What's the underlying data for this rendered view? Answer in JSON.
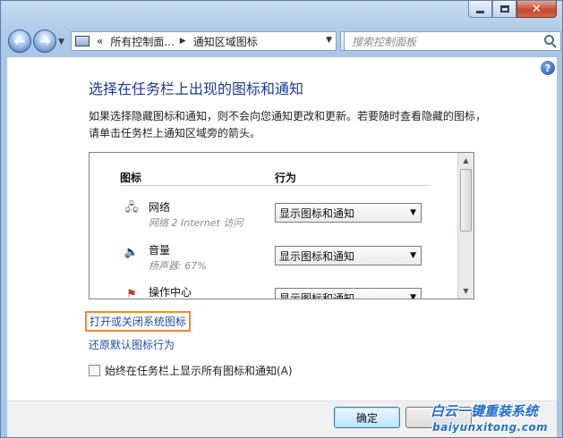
{
  "window": {
    "controls": {
      "minimize_icon": "minimize-icon",
      "maximize_icon": "maximize-icon",
      "close_glyph": "✕"
    }
  },
  "nav": {
    "back_glyph": "←",
    "forward_glyph": "→",
    "address": {
      "prefix": "«",
      "segments": [
        "所有控制面...",
        "通知区域图标"
      ]
    },
    "search_placeholder": "搜索控制面板"
  },
  "main": {
    "help_glyph": "?",
    "title": "选择在任务栏上出现的图标和通知",
    "description": "如果选择隐藏图标和通知，则不会向您通知更改和更新。若要随时查看隐藏的图标，请单击任务栏上通知区域旁的箭头。",
    "table": {
      "headers": {
        "icon": "图标",
        "action": "行为"
      },
      "rows": [
        {
          "name": "网络",
          "subtitle": "网络 2 Internet 访问",
          "behavior": "显示图标和通知",
          "icon": "network-icon"
        },
        {
          "name": "音量",
          "subtitle": "扬声器: 67%",
          "behavior": "显示图标和通知",
          "icon": "speaker-icon"
        },
        {
          "name": "操作中心",
          "subtitle": "",
          "behavior": "显示图标和通知",
          "icon": "action-center-flag-icon"
        }
      ]
    },
    "links": {
      "toggle_system_icons": "打开或关闭系统图标",
      "restore_default": "还原默认图标行为"
    },
    "checkbox": {
      "label": "始终在任务栏上显示所有图标和通知(A)",
      "checked": false
    }
  },
  "footer": {
    "ok_label": "确定",
    "cancel_label": ""
  },
  "watermark": {
    "title": "白云一键重装系统",
    "url": "baiyunxitong.com"
  },
  "colors": {
    "link": "#1f4fa8",
    "title": "#1f3a93",
    "highlight": "#f08a2c"
  }
}
